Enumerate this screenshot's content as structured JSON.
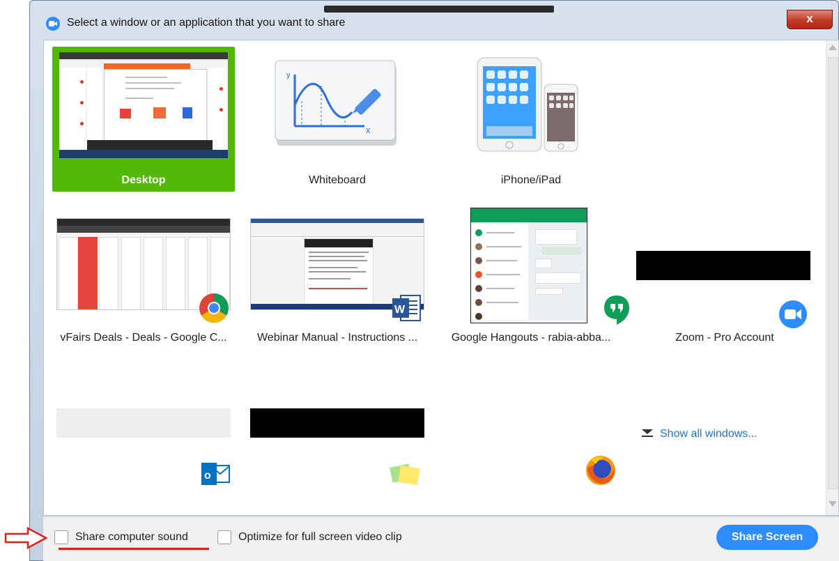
{
  "window": {
    "title": "Select a window or an application that you want to share",
    "close_label": "x"
  },
  "tiles": [
    {
      "label": "Desktop",
      "selected": true
    },
    {
      "label": "Whiteboard",
      "selected": false
    },
    {
      "label": "iPhone/iPad",
      "selected": false
    },
    {
      "label": "vFairs Deals - Deals - Google C...",
      "selected": false,
      "app_icon": "chrome-icon"
    },
    {
      "label": "Webinar Manual - Instructions ...",
      "selected": false,
      "app_icon": "word-icon"
    },
    {
      "label": "Google Hangouts - rabia-abba...",
      "selected": false,
      "app_icon": "hangouts-icon"
    },
    {
      "label": "Zoom - Pro Account",
      "selected": false,
      "app_icon": "zoom-icon"
    },
    {
      "label": "",
      "selected": false,
      "app_icon": "outlook-icon"
    },
    {
      "label": "",
      "selected": false,
      "app_icon": "sticky-notes-icon"
    },
    {
      "label": "",
      "selected": false,
      "app_icon": "firefox-icon"
    }
  ],
  "show_all_label": "Show all windows...",
  "footer": {
    "share_sound_label": "Share computer sound",
    "optimize_label": "Optimize for full screen video clip",
    "share_button_label": "Share Screen",
    "share_sound_checked": false,
    "optimize_checked": false
  },
  "colors": {
    "selected_tile": "#54b80a",
    "accent_blue": "#2d8cff",
    "annotation_red": "#e0201b"
  }
}
